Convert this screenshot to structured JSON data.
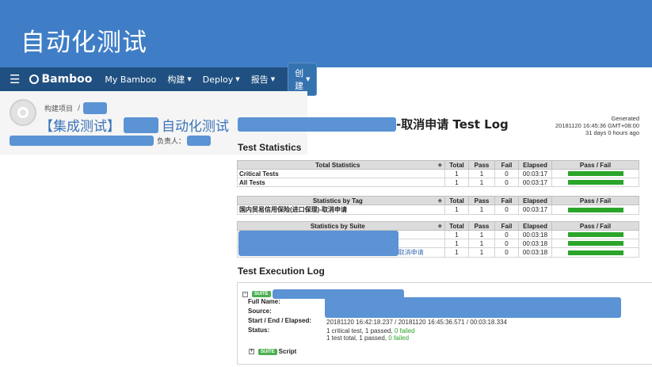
{
  "slide": {
    "title": "自动化测试"
  },
  "bamboo": {
    "menu_icon": "hamburger-menu-icon",
    "logo": "Bamboo",
    "nav": [
      "My Bamboo",
      "构建",
      "Deploy",
      "报告"
    ],
    "create_label": "创建",
    "breadcrumb": "构建项目",
    "breadcrumb_separator": "/",
    "plan_title_prefix": "【集成测试】",
    "plan_title_suffix": "自动化测试",
    "owner_label": "负责人："
  },
  "log": {
    "title_suffix": "-取消申请 Test Log",
    "generated": [
      "Generated",
      "20181120 16:45:36 GMT+08:00",
      "31 days 0 hours ago"
    ],
    "test_statistics_heading": "Test Statistics",
    "columns": [
      "Total",
      "Pass",
      "Fail",
      "Elapsed",
      "Pass / Fail"
    ],
    "sort_mark": "◆",
    "total_stats": {
      "title": "Total Statistics",
      "rows": [
        {
          "name": "Critical Tests",
          "total": "1",
          "pass": "1",
          "fail": "0",
          "elapsed": "00:03:17",
          "pass_ratio": 1
        },
        {
          "name": "All Tests",
          "total": "1",
          "pass": "1",
          "fail": "0",
          "elapsed": "00:03:17",
          "pass_ratio": 1
        }
      ]
    },
    "tag_stats": {
      "title": "Statistics by Tag",
      "rows": [
        {
          "name": "国内贸易信用保险(进口保理)-取消申请",
          "total": "1",
          "pass": "1",
          "fail": "0",
          "elapsed": "00:03:17",
          "pass_ratio": 1
        }
      ]
    },
    "suite_stats": {
      "title": "Statistics by Suite",
      "rows": [
        {
          "name": "",
          "total": "1",
          "pass": "1",
          "fail": "0",
          "elapsed": "00:03:18",
          "pass_ratio": 1
        },
        {
          "name": "",
          "total": "1",
          "pass": "1",
          "fail": "0",
          "elapsed": "00:03:18",
          "pass_ratio": 1
        },
        {
          "name": "-取消申请",
          "total": "1",
          "pass": "1",
          "fail": "0",
          "elapsed": "00:03:18",
          "pass_ratio": 1
        }
      ]
    },
    "execution_heading": "Test Execution Log",
    "suite_badge": "SUITE",
    "toggle_expanded": "−",
    "toggle_collapsed": "+",
    "labels": {
      "full_name": "Full Name:",
      "source": "Source:",
      "start_end": "Start / End / Elapsed:",
      "status": "Status:"
    },
    "start_end_value": "20181120 16:42:18.237 / 20181120 16:45:36.571 / 00:03:18.334",
    "status_critical_prefix": "1 critical test, 1 passed, ",
    "status_critical_failed": "0 failed",
    "status_total_prefix": "1 test total, 1 passed, ",
    "status_total_failed": "0 failed",
    "script_label": "Script"
  },
  "colors": {
    "slide_bar": "#3f7ec6",
    "bamboo_nav": "#205081",
    "pass": "#2aa52a",
    "redaction": "#5b93d4"
  }
}
